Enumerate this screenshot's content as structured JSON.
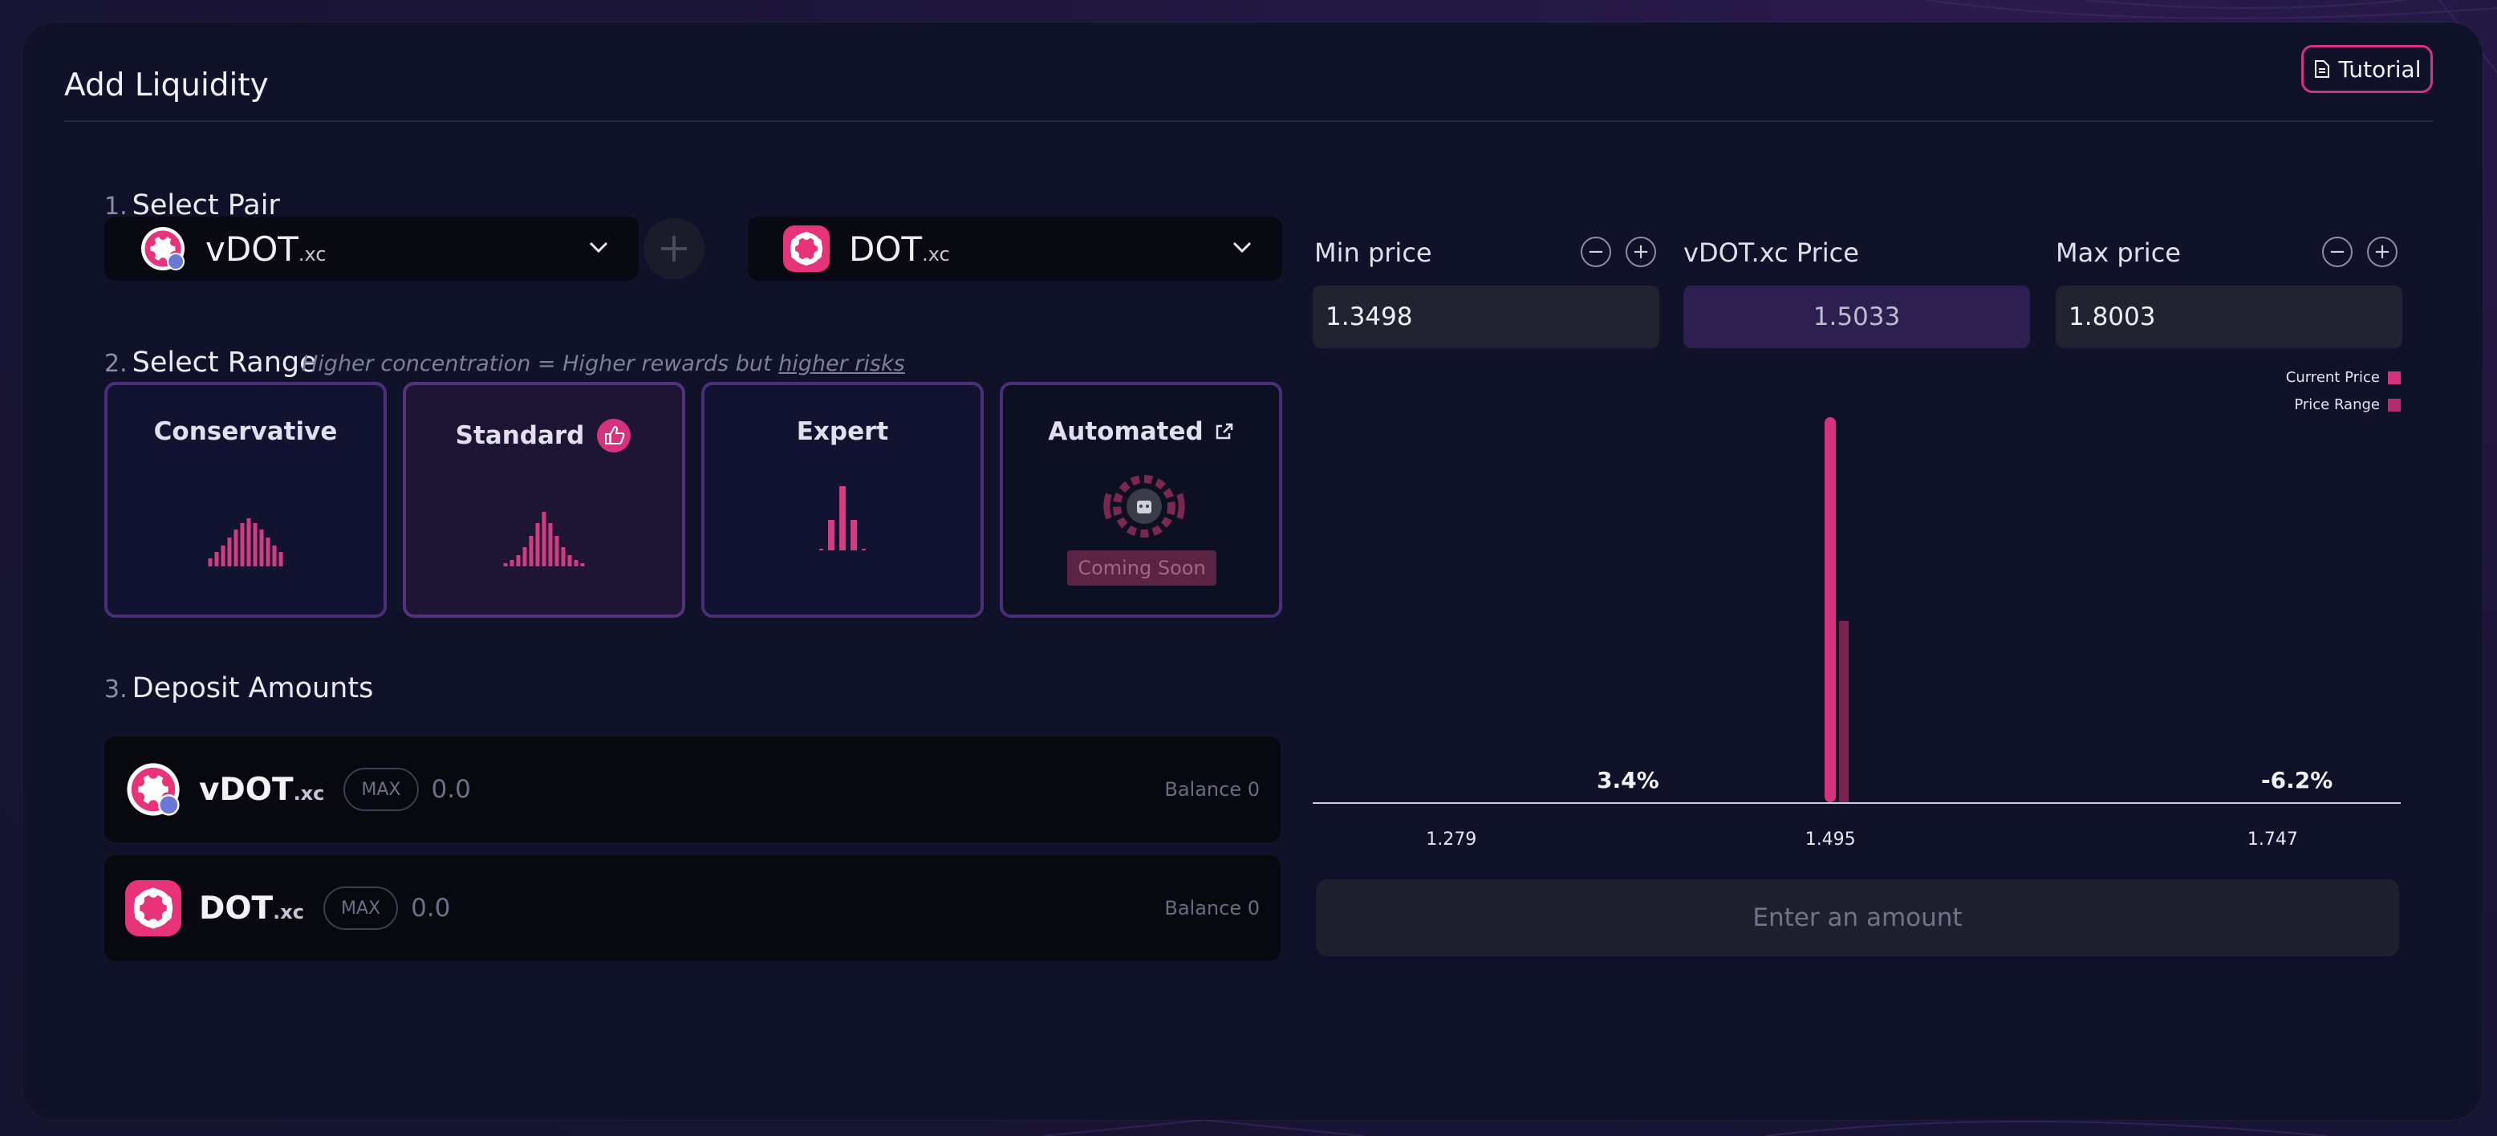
{
  "header": {
    "title": "Add Liquidity",
    "tutorial_label": "Tutorial"
  },
  "colors": {
    "accent": "#d3347a",
    "panel": "#10122a",
    "card_border": "#4a2f78",
    "range_bar": "#7c2450"
  },
  "select_pair": {
    "step": "1.",
    "title": "Select Pair",
    "token_a": {
      "name": "vDOT",
      "suffix": ".xc",
      "icon": "vdot-token-icon"
    },
    "token_b": {
      "name": "DOT",
      "suffix": ".xc",
      "icon": "dot-token-icon"
    }
  },
  "select_range": {
    "step": "2.",
    "title": "Select Range",
    "hint_prefix": "Higher concentration = Higher rewards but ",
    "hint_link": "higher risks",
    "options": [
      {
        "label": "Conservative",
        "icon": "distribution-wide-icon",
        "selected": false
      },
      {
        "label": "Standard",
        "icon": "thumbs-up-badge-icon",
        "selected": true
      },
      {
        "label": "Expert",
        "icon": "distribution-narrow-icon",
        "selected": false
      },
      {
        "label": "Automated",
        "icon": "external-link-icon",
        "selected": false,
        "badge": "Coming Soon"
      }
    ]
  },
  "deposit": {
    "step": "3.",
    "title": "Deposit Amounts",
    "rows": [
      {
        "token": "vDOT",
        "suffix": ".xc",
        "max_label": "MAX",
        "placeholder": "0.0",
        "balance": "Balance 0"
      },
      {
        "token": "DOT",
        "suffix": ".xc",
        "max_label": "MAX",
        "placeholder": "0.0",
        "balance": "Balance 0"
      }
    ]
  },
  "prices": {
    "min_label": "Min price",
    "min_value": "1.3498",
    "current_label": "vDOT.xc Price",
    "current_value": "1.5033",
    "max_label": "Max price",
    "max_value": "1.8003",
    "minus_symbol": "−",
    "plus_symbol": "+"
  },
  "legend": {
    "current": "Current Price",
    "range": "Price Range"
  },
  "chart_data": {
    "type": "bar",
    "series": [
      {
        "name": "Current Price",
        "x": 1.495,
        "height": 1.0,
        "color": "#d6337f"
      },
      {
        "name": "Price Range",
        "x": 1.5,
        "height": 0.47,
        "color": "#7c2450"
      }
    ],
    "x_ticks": [
      "1.279",
      "1.495",
      "1.747"
    ],
    "x_range": [
      1.2,
      1.82
    ],
    "annotations": {
      "min_pct": "3.4%",
      "max_pct": "-6.2%"
    }
  },
  "action": {
    "label": "Enter an amount"
  }
}
